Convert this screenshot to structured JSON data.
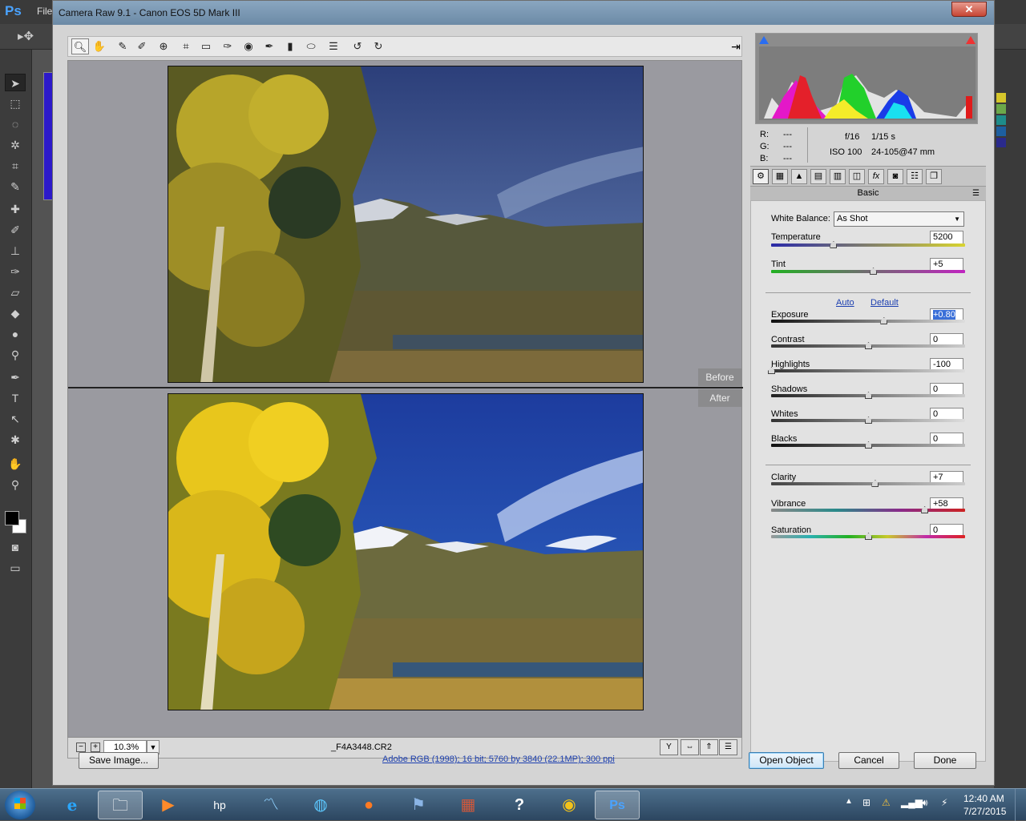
{
  "photoshop": {
    "logo": "Ps",
    "menu_file": "File"
  },
  "dialog": {
    "title": "Camera Raw 9.1  -  Canon EOS 5D Mark III",
    "close_glyph": "✕"
  },
  "preview": {
    "label_before": "Before",
    "label_after": "After",
    "zoom": "10.3%",
    "filename": "_F4A3448.CR2"
  },
  "camera_info": {
    "r_label": "R:",
    "r_value": "---",
    "g_label": "G:",
    "g_value": "---",
    "b_label": "B:",
    "b_value": "---",
    "aperture": "f/16",
    "shutter": "1/15 s",
    "iso": "ISO 100",
    "lens": "24-105@47 mm"
  },
  "panel": {
    "title": "Basic",
    "white_balance_label": "White Balance:",
    "white_balance_value": "As Shot",
    "auto_link": "Auto",
    "default_link": "Default",
    "sliders": [
      {
        "label": "Temperature",
        "value": "5200",
        "level": 0.32
      },
      {
        "label": "Tint",
        "value": "+5",
        "level": 0.525
      },
      {
        "label": "Exposure",
        "value": "+0.80",
        "level": 0.58
      },
      {
        "label": "Contrast",
        "value": "0",
        "level": 0.5
      },
      {
        "label": "Highlights",
        "value": "-100",
        "level": 0.0
      },
      {
        "label": "Shadows",
        "value": "0",
        "level": 0.5
      },
      {
        "label": "Whites",
        "value": "0",
        "level": 0.5
      },
      {
        "label": "Blacks",
        "value": "0",
        "level": 0.5
      },
      {
        "label": "Clarity",
        "value": "+7",
        "level": 0.535
      },
      {
        "label": "Vibrance",
        "value": "+58",
        "level": 0.79
      },
      {
        "label": "Saturation",
        "value": "0",
        "level": 0.5
      }
    ]
  },
  "footer": {
    "save_button": "Save Image...",
    "file_info": "Adobe RGB (1998); 16 bit; 5760 by 3840 (22.1MP); 300 ppi",
    "open_button": "Open Object",
    "cancel_button": "Cancel",
    "done_button": "Done"
  },
  "taskbar": {
    "time": "12:40 AM",
    "date": "7/27/2015"
  },
  "colors": {
    "sky": "#2a56b8",
    "foliage": "#e5c21a",
    "accent_link": "#1c3fb0"
  }
}
